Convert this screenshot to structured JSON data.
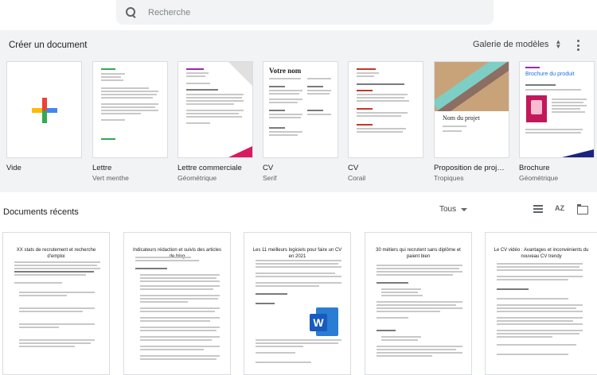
{
  "search": {
    "placeholder": "Recherche"
  },
  "gallery": {
    "title": "Créer un document",
    "gallery_button": "Galerie de modèles",
    "templates": [
      {
        "name": "Vide",
        "sub": ""
      },
      {
        "name": "Lettre",
        "sub": "Vert menthe"
      },
      {
        "name": "Lettre commerciale",
        "sub": "Géométrique"
      },
      {
        "name": "CV",
        "sub": "Serif"
      },
      {
        "name": "CV",
        "sub": "Corail"
      },
      {
        "name": "Proposition de proj…",
        "sub": "Tropiques"
      },
      {
        "name": "Brochure",
        "sub": "Géométrique"
      }
    ],
    "thumb_text": {
      "cv_serif_heading": "Votre nom",
      "project_heading": "Nom du projet",
      "brochure_heading": "Brochure du produit"
    }
  },
  "recent": {
    "title": "Documents récents",
    "owner_filter": "Tous",
    "sort_icon_text": "AZ",
    "docs": [
      {
        "title": "XX stats de recrutement et recherche d'emploi"
      },
      {
        "title": "Indicateurs rédaction et suivis des articles de blog"
      },
      {
        "title": "Les 11 meilleurs logiciels pour faire un CV en 2021"
      },
      {
        "title": "30 métiers qui recrutent sans diplôme et paient bien"
      },
      {
        "title": "Le CV vidéo : Avantages et inconvénients du nouveau CV trendy"
      }
    ],
    "word_logo_letter": "W"
  },
  "colors": {
    "gallery_bg": "#f1f3f4",
    "accent_blue": "#1a73e8",
    "google_red": "#ea4335",
    "google_yellow": "#fbbc04",
    "google_green": "#34a853",
    "google_blue": "#4285f4"
  }
}
